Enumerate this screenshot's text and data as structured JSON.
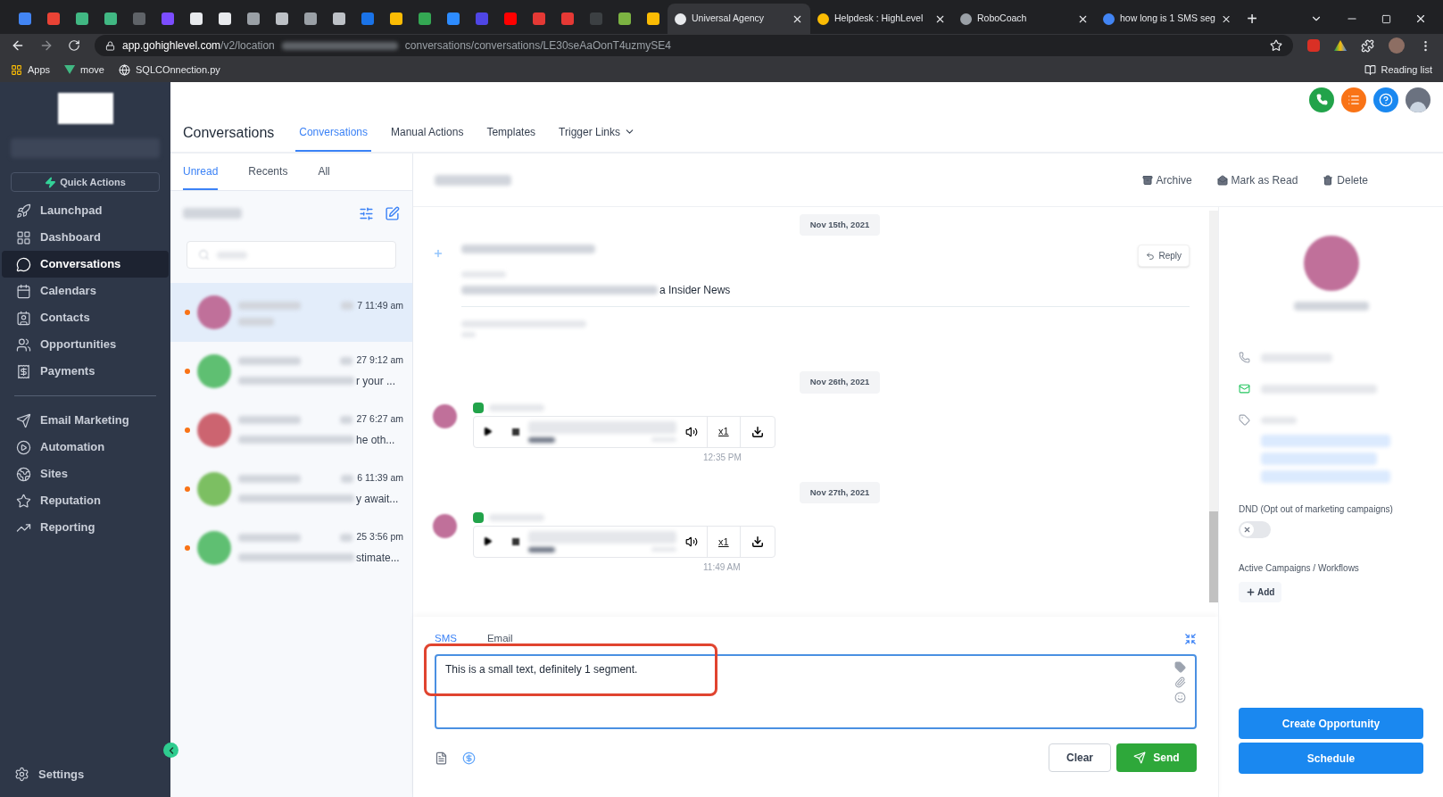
{
  "browser": {
    "pinned_tabs": [
      {
        "color": "#4285f4"
      },
      {
        "color": "#ea4335"
      },
      {
        "color": "#41b883"
      },
      {
        "color": "#41b883"
      },
      {
        "color": "#5f6368"
      },
      {
        "color": "#7c4dff"
      },
      {
        "color": "#e8eaed"
      },
      {
        "color": "#e8eaed"
      },
      {
        "color": "#9aa0a6"
      },
      {
        "color": "#bdc1c6"
      },
      {
        "color": "#9aa0a6"
      },
      {
        "color": "#bdc1c6"
      },
      {
        "color": "#1a73e8"
      },
      {
        "color": "#fbbc04"
      },
      {
        "color": "#34a853"
      },
      {
        "color": "#2d8cff"
      },
      {
        "color": "#4f46e5"
      },
      {
        "color": "#ff0000"
      },
      {
        "color": "#e53935"
      },
      {
        "color": "#e53935"
      },
      {
        "color": "#3c4043"
      },
      {
        "color": "#7cb342"
      },
      {
        "color": "#fbbc04"
      }
    ],
    "tabs": [
      {
        "title": "Universal Agency",
        "selected": true,
        "color": "#e8eaed"
      },
      {
        "title": "Helpdesk : HighLevel",
        "selected": false,
        "color": "#fbbc04"
      },
      {
        "title": "RoboCoach",
        "selected": false,
        "color": "#9aa0a6"
      },
      {
        "title": "how long is 1 SMS seg",
        "selected": false,
        "color": "#4285f4"
      }
    ],
    "new_tab": "+",
    "url": {
      "host": "app.gohighlevel.com",
      "path_start": "/v2/location",
      "path_end": "conversations/conversations/LE30seAaOonT4uzmySE4"
    },
    "bookmarks": [
      {
        "label": "Apps",
        "kind": "apps"
      },
      {
        "label": "move",
        "kind": "vue"
      },
      {
        "label": "SQLCOnnection.py",
        "kind": "globe"
      }
    ],
    "reading_list": "Reading list"
  },
  "sidebar": {
    "quick_actions": "Quick Actions",
    "items": [
      {
        "label": "Launchpad",
        "selected": false
      },
      {
        "label": "Dashboard",
        "selected": false
      },
      {
        "label": "Conversations",
        "selected": true
      },
      {
        "label": "Calendars",
        "selected": false
      },
      {
        "label": "Contacts",
        "selected": false
      },
      {
        "label": "Opportunities",
        "selected": false
      },
      {
        "label": "Payments",
        "selected": false
      }
    ],
    "items_2": [
      {
        "label": "Email Marketing",
        "selected": false
      },
      {
        "label": "Automation",
        "selected": false
      },
      {
        "label": "Sites",
        "selected": false
      },
      {
        "label": "Reputation",
        "selected": false
      },
      {
        "label": "Reporting",
        "selected": false
      }
    ],
    "settings": "Settings"
  },
  "header": {
    "title": "Conversations",
    "tabs": [
      {
        "label": "Conversations",
        "selected": true,
        "dropdown": false
      },
      {
        "label": "Manual Actions",
        "selected": false,
        "dropdown": false
      },
      {
        "label": "Templates",
        "selected": false,
        "dropdown": false
      },
      {
        "label": "Trigger Links",
        "selected": false,
        "dropdown": true
      }
    ]
  },
  "list": {
    "tabs": [
      {
        "label": "Unread",
        "selected": true
      },
      {
        "label": "Recents",
        "selected": false
      },
      {
        "label": "All",
        "selected": false
      }
    ],
    "conversations": [
      {
        "time": "7 11:49 am",
        "unread": true,
        "selected": true
      },
      {
        "time": "27 9:12 am",
        "preview": "r your ...",
        "unread": true,
        "selected": false
      },
      {
        "time": "27 6:27 am",
        "preview": "he oth...",
        "unread": true,
        "selected": false
      },
      {
        "time": "6 11:39 am",
        "preview": "y await...",
        "unread": true,
        "selected": false
      },
      {
        "time": "25 3:56 pm",
        "preview": "stimate...",
        "unread": true,
        "selected": false
      }
    ]
  },
  "thread": {
    "actions": [
      {
        "label": "Archive"
      },
      {
        "label": "Mark as Read"
      },
      {
        "label": "Delete"
      }
    ],
    "messages": [
      {
        "kind": "date",
        "label": "Nov 15th, 2021"
      },
      {
        "kind": "email",
        "subject_end": "a Insider News",
        "reply": "Reply"
      },
      {
        "kind": "date",
        "label": "Nov 26th, 2021"
      },
      {
        "kind": "call",
        "speed": "x1",
        "time": "12:35 PM"
      },
      {
        "kind": "date",
        "label": "Nov 27th, 2021"
      },
      {
        "kind": "call",
        "speed": "x1",
        "time": "11:49 AM"
      }
    ]
  },
  "composer": {
    "tabs": [
      {
        "label": "SMS",
        "selected": true
      },
      {
        "label": "Email",
        "selected": false
      }
    ],
    "value": "This is a small text, definitely 1 segment.",
    "clear": "Clear",
    "send": "Send"
  },
  "contact": {
    "dnd_label": "DND (Opt out of marketing campaigns)",
    "dnd_on": false,
    "campaigns_label": "Active Campaigns / Workflows",
    "add": "Add",
    "create_opportunity": "Create Opportunity",
    "schedule": "Schedule"
  }
}
